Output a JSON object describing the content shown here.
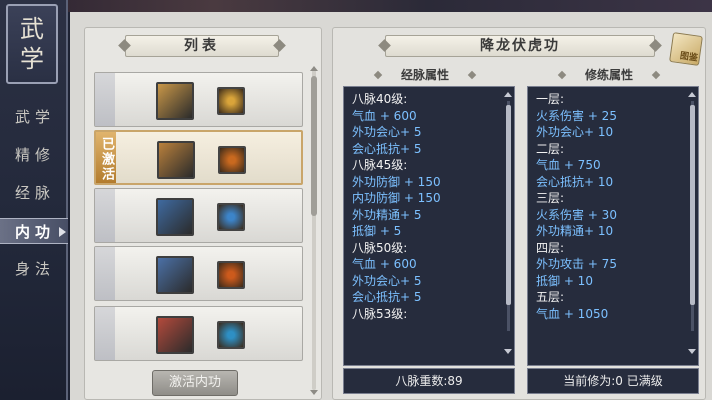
{
  "sidebar": {
    "title_chars": [
      "武",
      "学"
    ],
    "items": [
      {
        "label": "武学",
        "active": false
      },
      {
        "label": "精修",
        "active": false
      },
      {
        "label": "经脉",
        "active": false
      },
      {
        "label": "内功",
        "active": true
      },
      {
        "label": "身法",
        "active": false
      }
    ]
  },
  "list": {
    "header": "列表",
    "activated_tag": "已激活",
    "activate_button": "激活内功",
    "rows": [
      {
        "book_color": "#c99748",
        "skill_color": "#d9a43a",
        "book_icon": "yellow-scripture-icon",
        "skill_icon": "golden-burst-icon",
        "selected": false
      },
      {
        "book_color": "#b9803c",
        "skill_color": "#c9691f",
        "book_icon": "yellow-scripture-icon",
        "skill_icon": "fire-claw-icon",
        "selected": true
      },
      {
        "book_color": "#3f6aa0",
        "skill_color": "#3c84c9",
        "book_icon": "blue-scripture-icon",
        "skill_icon": "blue-slash-icon",
        "selected": false
      },
      {
        "book_color": "#4b70a6",
        "skill_color": "#cc5a1c",
        "book_icon": "blue-scripture-icon",
        "skill_icon": "fire-sword-icon",
        "selected": false
      },
      {
        "book_color": "#b34a3c",
        "skill_color": "#2e8fc4",
        "book_icon": "red-scripture-icon",
        "skill_icon": "taiji-icon",
        "selected": false
      }
    ]
  },
  "detail": {
    "title": "降龙伏虎功",
    "guide_label": "图鉴",
    "meridian_header": "经脉属性",
    "cultivation_header": "修练属性",
    "meridian_lines": [
      {
        "text": "八脉40级:",
        "type": "head"
      },
      {
        "text": "气血 + 600",
        "type": "stat"
      },
      {
        "text": "外功会心+ 5",
        "type": "stat"
      },
      {
        "text": "会心抵抗+ 5",
        "type": "stat"
      },
      {
        "text": "八脉45级:",
        "type": "head"
      },
      {
        "text": "外功防御 + 150",
        "type": "stat"
      },
      {
        "text": "内功防御 + 150",
        "type": "stat"
      },
      {
        "text": "外功精通+ 5",
        "type": "stat"
      },
      {
        "text": "抵御 + 5",
        "type": "stat"
      },
      {
        "text": "八脉50级:",
        "type": "head"
      },
      {
        "text": "气血 + 600",
        "type": "stat"
      },
      {
        "text": "外功会心+ 5",
        "type": "stat"
      },
      {
        "text": "会心抵抗+ 5",
        "type": "stat"
      },
      {
        "text": "八脉53级:",
        "type": "head"
      }
    ],
    "cultivation_lines": [
      {
        "text": "一层:",
        "type": "head"
      },
      {
        "text": "火系伤害 + 25",
        "type": "stat"
      },
      {
        "text": "外功会心+ 10",
        "type": "stat"
      },
      {
        "text": "二层:",
        "type": "head"
      },
      {
        "text": "气血 + 750",
        "type": "stat"
      },
      {
        "text": "会心抵抗+ 10",
        "type": "stat"
      },
      {
        "text": "三层:",
        "type": "head"
      },
      {
        "text": "火系伤害 + 30",
        "type": "stat"
      },
      {
        "text": "外功精通+ 10",
        "type": "stat"
      },
      {
        "text": "四层:",
        "type": "head"
      },
      {
        "text": "外功攻击 + 75",
        "type": "stat"
      },
      {
        "text": "抵御 + 10",
        "type": "stat"
      },
      {
        "text": "五层:",
        "type": "head"
      },
      {
        "text": "气血 + 1050",
        "type": "stat"
      }
    ],
    "meridian_footer": "八脉重数:89",
    "cultivation_footer": "当前修为:0 已满级"
  }
}
